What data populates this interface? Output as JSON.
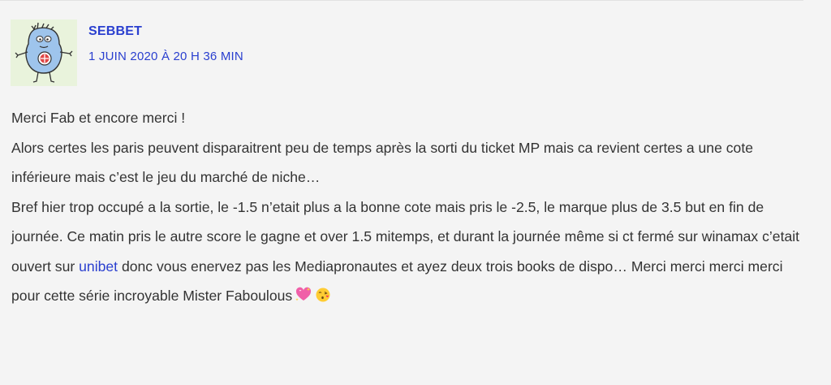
{
  "comment": {
    "author": "SEBBET",
    "date": "1 JUIN 2020 À 20 H 36 MIN",
    "line1": "Merci Fab et encore merci !",
    "para2": "Alors certes les paris peuvent disparaitrent peu de temps après la sorti du ticket MP mais ca revient certes a une cote inférieure mais c’est le jeu du marché de niche…",
    "para3_before": "Bref hier trop occupé a la sortie, le -1.5 n’etait plus a la bonne cote mais pris le -2.5, le marque plus de 3.5 but en fin de journée. Ce matin pris le autre score le gagne et over 1.5 mitemps, et durant la journée même si ct fermé sur winamax c’etait ouvert sur ",
    "para3_link": "unibet",
    "para3_after": " donc vous enervez pas les Mediapronautes et ayez deux trois books de dispo… Merci merci merci merci pour cette série incroyable Mister Faboulous",
    "emojis": [
      "sparkling-heart-icon",
      "face-blowing-kiss-icon"
    ]
  },
  "colors": {
    "link": "#2a3fcf",
    "text": "#333333",
    "background": "#f4f4f4",
    "avatar_bg": "#e9f3dc"
  }
}
